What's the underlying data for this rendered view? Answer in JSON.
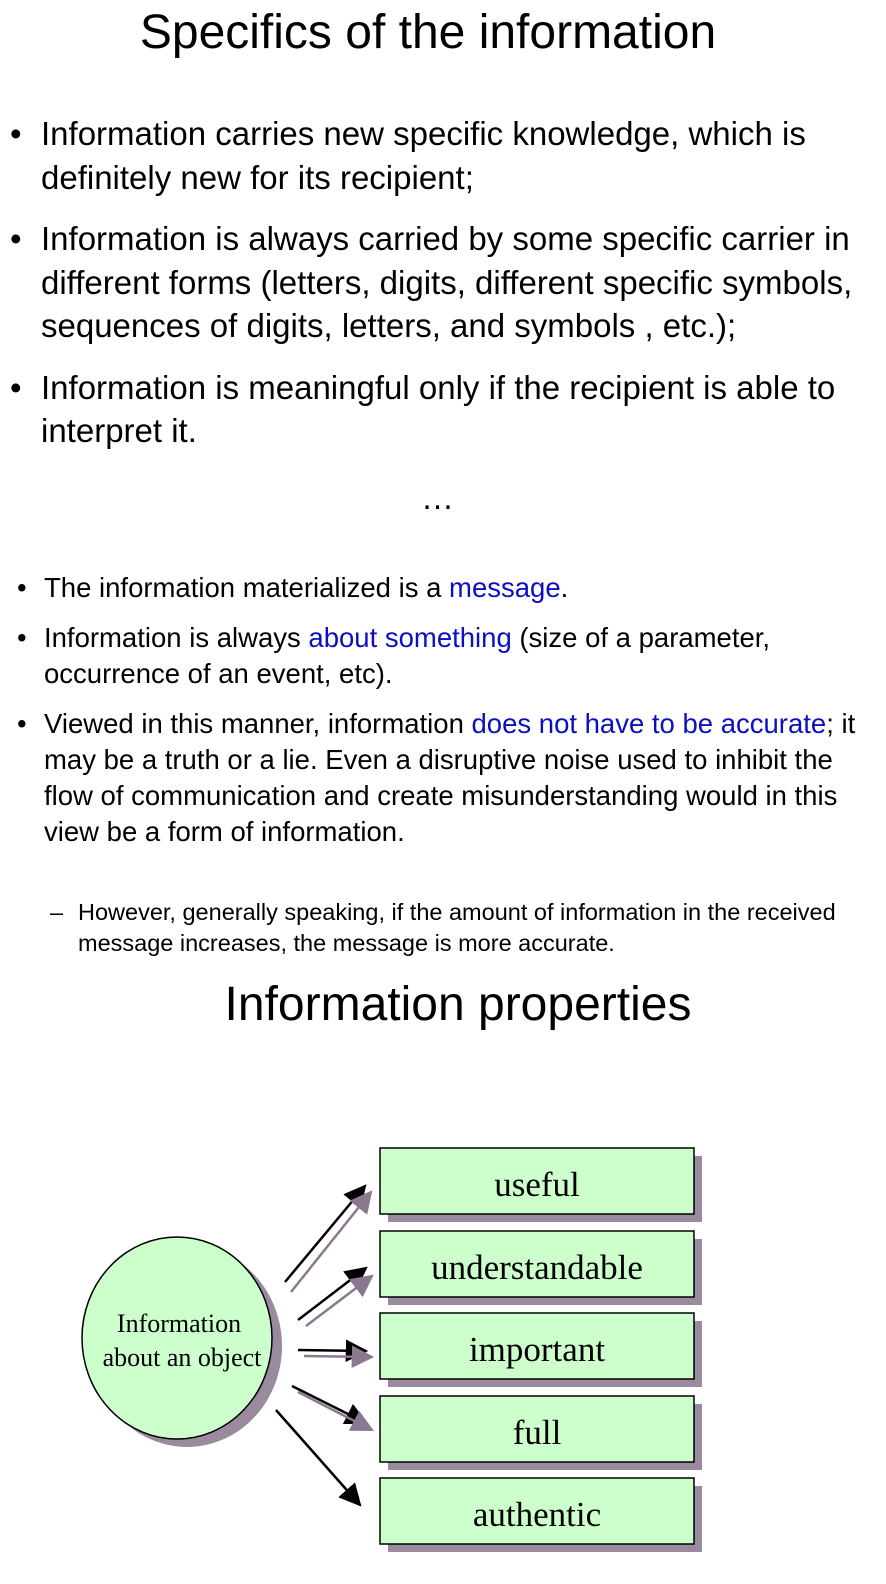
{
  "slide1": {
    "title": "Specifics of the information",
    "bullets": [
      "Information carries new specific knowledge, which is definitely new for its recipient;",
      "Information is always carried by some specific carrier in different forms (letters, digits, different specific symbols, sequences of digits, letters, and symbols , etc.);",
      "Information is meaningful only if the recipient is able to interpret  it."
    ],
    "ellipsis": "…"
  },
  "slide2": {
    "b1": {
      "pre": "The information materialized is a ",
      "link": "message",
      "post": "."
    },
    "b2": {
      "pre": "Information is always ",
      "link": "about something",
      "post": " (size of a parameter, occurrence of an event, etc)."
    },
    "b3": {
      "pre": "Viewed in this manner, information ",
      "link": "does not have to be accurate",
      "post": "; it may be a truth or a lie.  Even a disruptive noise used to inhibit the flow of communication and create misunderstanding would in this view be a form of information."
    },
    "sub": "However, generally speaking, if the amount of information in the received message increases, the message is more accurate."
  },
  "slide3": {
    "title": "Information properties",
    "center_line1": "Information",
    "center_line2": "about an object",
    "properties": [
      "useful",
      "understandable",
      "important",
      "full",
      "authentic"
    ],
    "colors": {
      "fill": "#ccffcc",
      "shadow": "#9a8aa0",
      "arrow_shade": "#8a7890",
      "link": "#0b0fc1"
    }
  }
}
